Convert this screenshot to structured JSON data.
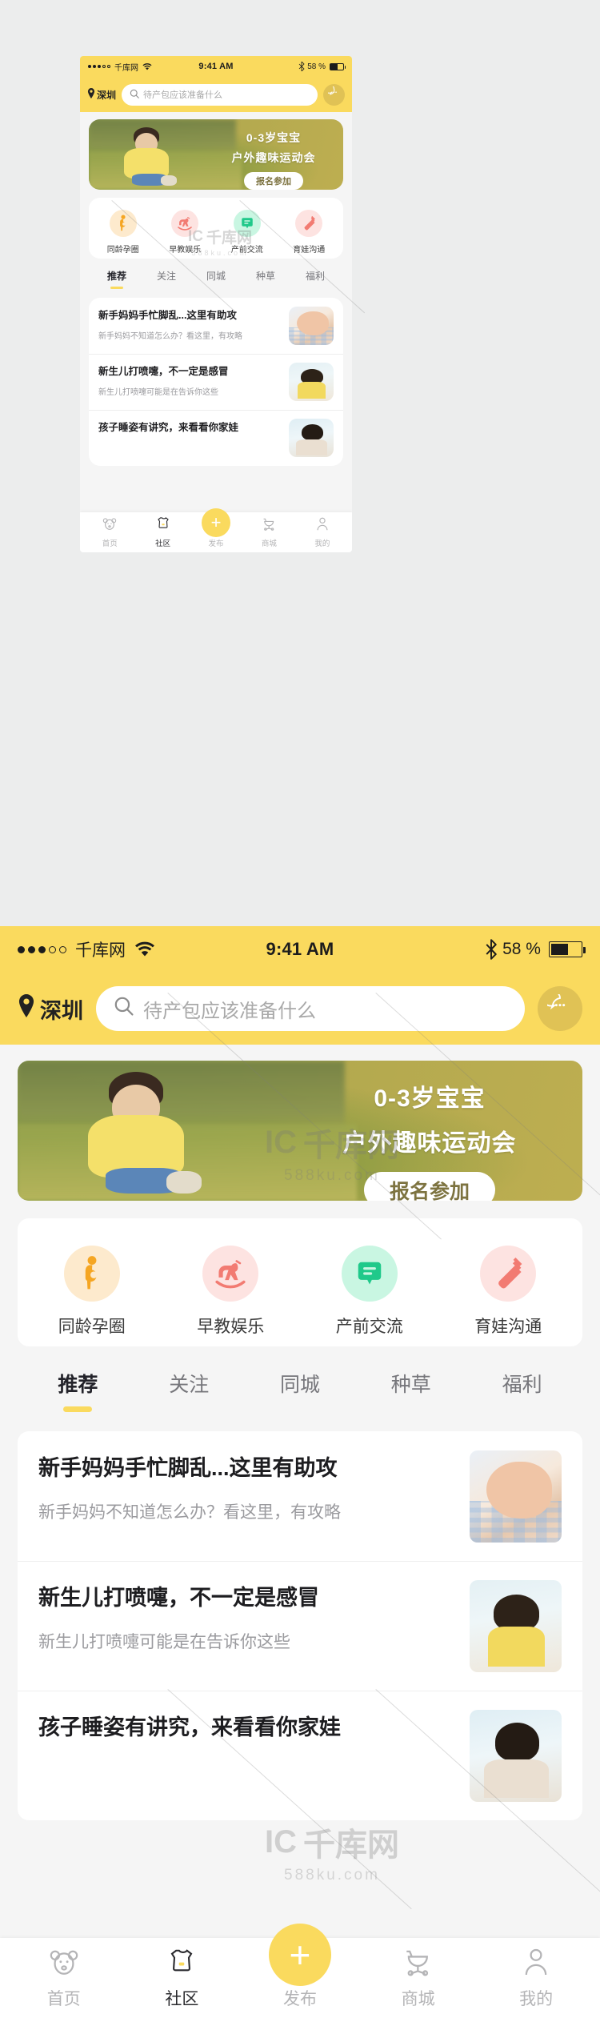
{
  "theme": {
    "accent": "#fada5e",
    "accent_dark": "#e0c255",
    "page_bg": "#eceded",
    "card_bg": "#ffffff",
    "text_primary": "#1d1d20",
    "text_secondary": "#9b9b9f",
    "green": "#3ddc97",
    "orange": "#f5a623",
    "red": "#f2756b"
  },
  "status_bar": {
    "carrier": "千库网",
    "time": "9:41 AM",
    "battery_percent": "58 %",
    "signal_dots_filled": 3,
    "signal_dots_total": 5,
    "wifi_icon": "wifi-icon",
    "bluetooth_icon": "bluetooth-icon",
    "battery_icon": "battery-icon"
  },
  "header": {
    "location_icon": "location-pin-icon",
    "location": "深圳",
    "search_icon": "search-icon",
    "search_value": "",
    "search_placeholder": "待产包应该准备什么",
    "message_button": "message-dots-icon"
  },
  "banner": {
    "line1": "0-3岁宝宝",
    "line2": "户外趣味运动会",
    "cta": "报名参加"
  },
  "categories": [
    {
      "label": "同龄孕圈",
      "icon": "pregnant-woman-icon",
      "bubble": "#fdeacd",
      "fg": "#f5a623"
    },
    {
      "label": "早教娱乐",
      "icon": "rocking-horse-icon",
      "bubble": "#fde3e1",
      "fg": "#f27b72"
    },
    {
      "label": "产前交流",
      "icon": "speech-bubble-icon",
      "bubble": "#c9f6e2",
      "fg": "#1fc98a"
    },
    {
      "label": "育娃沟通",
      "icon": "baby-bottle-icon",
      "bubble": "#fde3e1",
      "fg": "#f27b72"
    }
  ],
  "tabs": [
    {
      "label": "推荐",
      "active": true
    },
    {
      "label": "关注",
      "active": false
    },
    {
      "label": "同城",
      "active": false
    },
    {
      "label": "种草",
      "active": false
    },
    {
      "label": "福利",
      "active": false
    }
  ],
  "articles": [
    {
      "title": "新手妈妈手忙脚乱...这里有助攻",
      "summary": "新手妈妈不知道怎么办？看这里，有攻略",
      "thumb": "baby-hand-photo"
    },
    {
      "title": "新生儿打喷嚏，不一定是感冒",
      "summary": "新生儿打喷嚏可能是在告诉你这些",
      "thumb": "child-painting-photo"
    },
    {
      "title": "孩子睡姿有讲究，来看看你家娃",
      "summary": "",
      "thumb": "child-sleeping-photo"
    }
  ],
  "bottom_nav": {
    "items": [
      {
        "label": "首页",
        "icon": "bear-face-icon",
        "active": false
      },
      {
        "label": "社区",
        "icon": "onesie-icon",
        "active": true
      },
      {
        "label": "发布",
        "icon": "plus-icon",
        "active": false
      },
      {
        "label": "商城",
        "icon": "stroller-icon",
        "active": false
      },
      {
        "label": "我的",
        "icon": "person-icon",
        "active": false
      }
    ],
    "fab_label": "+"
  },
  "watermark": {
    "mark": "千库网",
    "domain": "588ku.com"
  }
}
